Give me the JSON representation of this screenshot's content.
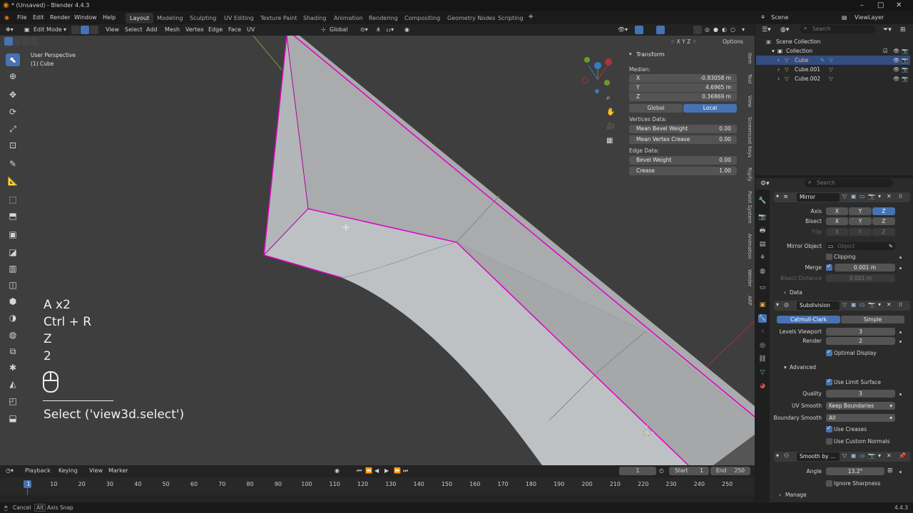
{
  "window": {
    "title": "* (Unsaved) - Blender 4.4.3",
    "menu": [
      "File",
      "Edit",
      "Render",
      "Window",
      "Help"
    ],
    "workspaces": [
      "Layout",
      "Modeling",
      "Sculpting",
      "UV Editing",
      "Texture Paint",
      "Shading",
      "Animation",
      "Rendering",
      "Compositing",
      "Geometry Nodes",
      "Scripting"
    ],
    "active_workspace": "Layout",
    "scene": "Scene",
    "view_layer": "ViewLayer",
    "version": "4.4.3"
  },
  "viewport_header": {
    "mode": "Edit Mode",
    "menus": [
      "View",
      "Select",
      "Add",
      "Mesh",
      "Vertex",
      "Edge",
      "Face",
      "UV"
    ],
    "transform_orientation": "Global",
    "options_label": "Options",
    "axes": [
      "X",
      "Y",
      "Z"
    ]
  },
  "viewport": {
    "view_name": "User Perspective",
    "object_name": "(1) Cube"
  },
  "key_overlay": {
    "keys": [
      "A x2",
      "Ctrl + R",
      "Z",
      "2"
    ],
    "operator": "Select ('view3d.select')"
  },
  "n_panel": {
    "title": "Transform",
    "median_label": "Median:",
    "median": [
      {
        "axis": "X",
        "value": "-0.83058 m"
      },
      {
        "axis": "Y",
        "value": "4.6965 m"
      },
      {
        "axis": "Z",
        "value": "0.36869 m"
      }
    ],
    "space_global": "Global",
    "space_local": "Local",
    "vertices_data_label": "Vertices Data:",
    "mean_bevel_weight": {
      "label": "Mean Bevel Weight",
      "value": "0.00"
    },
    "mean_vertex_crease": {
      "label": "Mean Vertex Crease",
      "value": "0.00"
    },
    "edge_data_label": "Edge Data:",
    "bevel_weight": {
      "label": "Bevel Weight",
      "value": "0.00"
    },
    "crease": {
      "label": "Crease",
      "value": "1.00"
    },
    "side_tabs": [
      "Item",
      "Tool",
      "View",
      "Screencast Keys",
      "Rigify",
      "Paint System",
      "Animation",
      "Welder",
      "ARP"
    ]
  },
  "outliner": {
    "search_placeholder": "Search",
    "root": "Scene Collection",
    "collection": "Collection",
    "objects": [
      "Cube",
      "Cube.001",
      "Cube.002"
    ]
  },
  "properties": {
    "search_placeholder": "Search",
    "mirror": {
      "name": "Mirror",
      "axis_label": "Axis",
      "bisect_label": "Bisect",
      "flip_label": "Flip",
      "axes": [
        "X",
        "Y",
        "Z"
      ],
      "mirror_object_label": "Mirror Object",
      "mirror_object_placeholder": "Object",
      "clipping_label": "Clipping",
      "merge_label": "Merge",
      "merge_value": "0.001 m",
      "bisect_distance_label": "Bisect Distance",
      "bisect_distance_value": "0.001 m",
      "data_label": "Data"
    },
    "subdivision": {
      "name": "Subdivision",
      "catmull": "Catmull-Clark",
      "simple": "Simple",
      "levels_viewport_label": "Levels Viewport",
      "levels_viewport": "3",
      "render_label": "Render",
      "render": "2",
      "optimal_display": "Optimal Display",
      "advanced_label": "Advanced",
      "use_limit_surface": "Use Limit Surface",
      "quality_label": "Quality",
      "quality": "3",
      "uv_smooth_label": "UV Smooth",
      "uv_smooth": "Keep Boundaries",
      "boundary_smooth_label": "Boundary Smooth",
      "boundary_smooth": "All",
      "use_creases": "Use Creases",
      "use_custom_normals": "Use Custom Normals"
    },
    "smooth": {
      "name": "Smooth by ...",
      "angle_label": "Angle",
      "angle": "13.2°",
      "ignore_sharpness": "Ignore Sharpness",
      "manage_label": "Manage"
    }
  },
  "timeline": {
    "menus": [
      "Playback",
      "Keying",
      "View",
      "Marker"
    ],
    "current_frame": "1",
    "start_label": "Start",
    "start": "1",
    "end_label": "End",
    "end": "250",
    "ticks": [
      "1",
      "10",
      "20",
      "30",
      "40",
      "50",
      "60",
      "70",
      "80",
      "90",
      "100",
      "110",
      "120",
      "130",
      "140",
      "150",
      "160",
      "170",
      "180",
      "190",
      "200",
      "210",
      "220",
      "230",
      "240",
      "250"
    ]
  },
  "statusbar": {
    "cancel": "Cancel",
    "alt_key": "Alt",
    "axis_snap": "Axis Snap",
    "version": "4.4.3"
  },
  "colors": {
    "accent": "#4772b3",
    "selection_edge": "#e000c8",
    "mesh_face": "#b8bcbe"
  }
}
